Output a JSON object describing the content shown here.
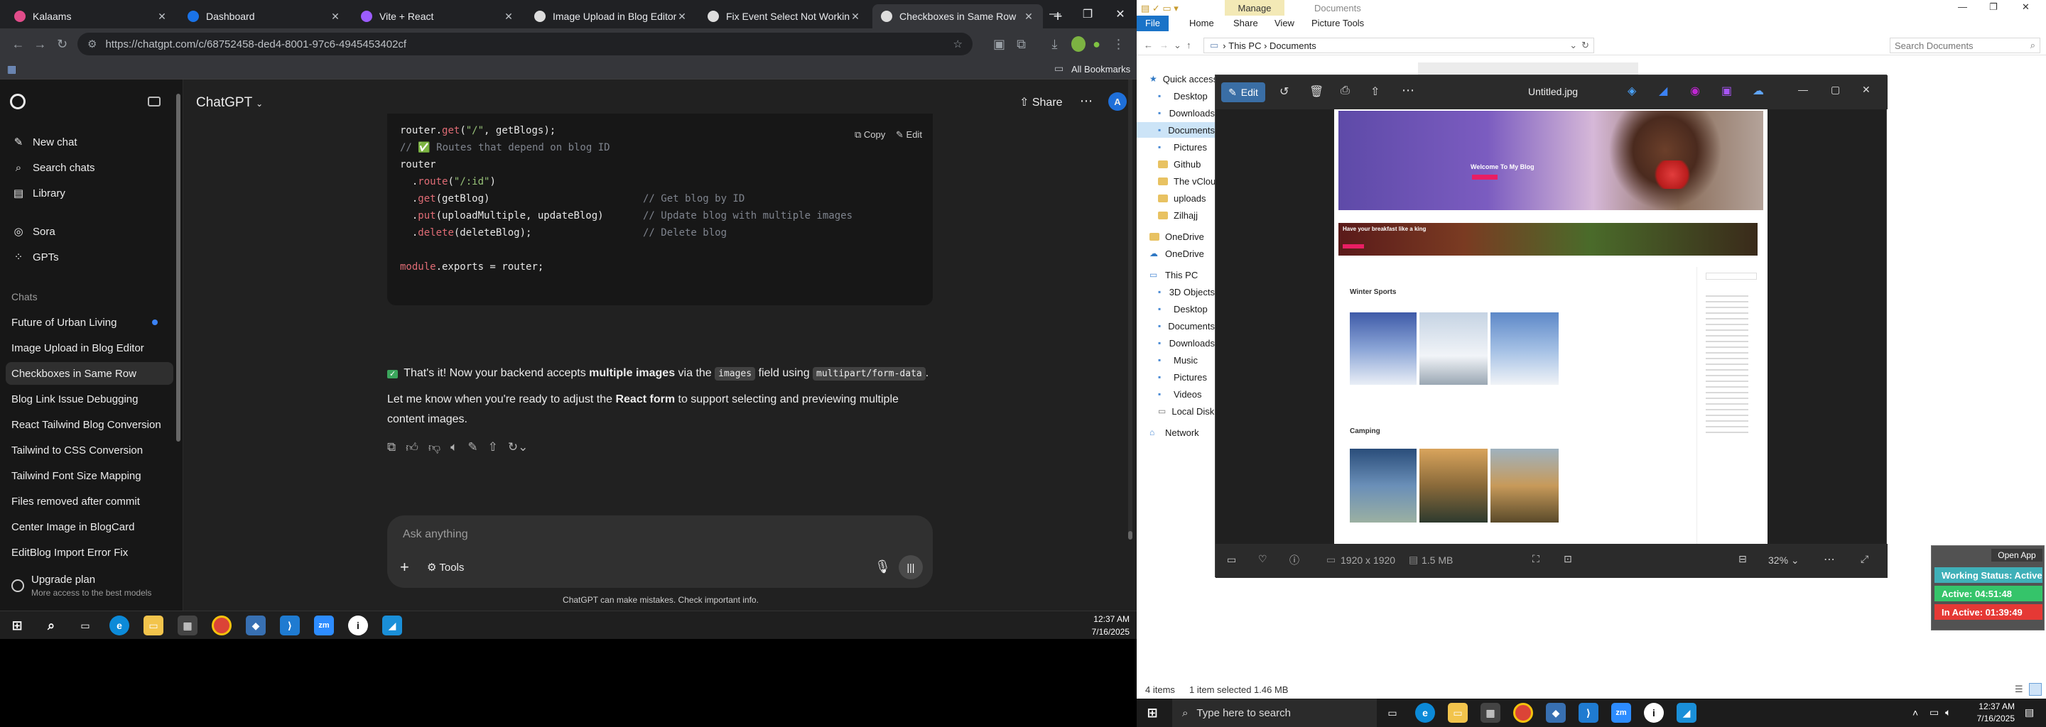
{
  "browser": {
    "tabs": [
      {
        "title": "Kalaams",
        "color": "#e14c8a"
      },
      {
        "title": "Dashboard",
        "color": "#1a73e8"
      },
      {
        "title": "Vite + React",
        "color": "#9c5cff"
      },
      {
        "title": "Image Upload in Blog Editor",
        "color": "#dddddd"
      },
      {
        "title": "Fix Event Select Not Working",
        "color": "#dddddd"
      },
      {
        "title": "Checkboxes in Same Row",
        "color": "#dddddd",
        "active": true
      }
    ],
    "url": "https://chatgpt.com/c/68752458-ded4-8001-97c6-4945453402cf",
    "all_bookmarks": "All Bookmarks"
  },
  "chatgpt": {
    "title": "ChatGPT",
    "share_label": "Share",
    "avatar_letter": "A",
    "sidebar": {
      "new_chat": "New chat",
      "search_chats": "Search chats",
      "library": "Library",
      "sora": "Sora",
      "gpts": "GPTs",
      "chats_heading": "Chats",
      "chats": [
        "Future of Urban Living",
        "Image Upload in Blog Editor",
        "Checkboxes in Same Row",
        "Blog Link Issue Debugging",
        "React Tailwind Blog Conversion",
        "Tailwind to CSS Conversion",
        "Tailwind Font Size Mapping",
        "Files removed after commit",
        "Center Image in BlogCard",
        "EditBlog Import Error Fix"
      ],
      "upgrade_title": "Upgrade plan",
      "upgrade_sub": "More access to the best models"
    },
    "code": {
      "copy": "Copy",
      "edit": "Edit",
      "lines": [
        {
          "pre": "router.",
          "fn": "get",
          "args": "(\"/\", getBlogs);",
          "comment": ""
        },
        {
          "pre": "",
          "fn": "",
          "args": "",
          "comment": "// ✅ Routes that depend on blog ID"
        },
        {
          "pre": "router",
          "fn": "",
          "args": "",
          "comment": ""
        },
        {
          "pre": "  .",
          "fn": "route",
          "args": "(\"/:id\")",
          "comment": ""
        },
        {
          "pre": "  .",
          "fn": "get",
          "args": "(getBlog)",
          "comment": "// Get blog by ID"
        },
        {
          "pre": "  .",
          "fn": "put",
          "args": "(uploadMultiple, updateBlog)",
          "comment": "// Update blog with multiple images"
        },
        {
          "pre": "  .",
          "fn": "delete",
          "args": "(deleteBlog);",
          "comment": "// Delete blog"
        },
        {
          "pre": "",
          "fn": "",
          "args": "",
          "comment": ""
        },
        {
          "pre": "module",
          "fn": "",
          "args": ".exports = router;",
          "comment": ""
        }
      ]
    },
    "message": {
      "p1_a": "That's it! Now your backend accepts ",
      "p1_b": "multiple images",
      "p1_c": " via the ",
      "p1_code1": "images",
      "p1_d": " field using ",
      "p1_code2": "multipart/form-data",
      "p1_e": ".",
      "p2_a": "Let me know when you're ready to adjust the ",
      "p2_b": "React form",
      "p2_c": " to support selecting and previewing multiple",
      "p2_d": "content images."
    },
    "composer": {
      "placeholder": "Ask anything",
      "tools": "Tools"
    },
    "disclaimer": "ChatGPT can make mistakes. Check important info."
  },
  "taskbar_left": {
    "time": "12:37 AM",
    "date": "7/16/2025"
  },
  "explorer": {
    "manage": "Manage",
    "documents_title": "Documents",
    "tabs": [
      "File",
      "Home",
      "Share",
      "View",
      "Picture Tools"
    ],
    "breadcrumb": [
      "This PC",
      "Documents"
    ],
    "search_placeholder": "Search Documents",
    "nav": [
      {
        "label": "Quick access",
        "type": "star"
      },
      {
        "label": "Desktop",
        "type": "blue"
      },
      {
        "label": "Downloads",
        "type": "blue"
      },
      {
        "label": "Documents",
        "type": "blue",
        "selected": true
      },
      {
        "label": "Pictures",
        "type": "blue"
      },
      {
        "label": "Github",
        "type": "folder"
      },
      {
        "label": "The vCloud",
        "type": "folder"
      },
      {
        "label": "uploads",
        "type": "folder"
      },
      {
        "label": "Zilhajj",
        "type": "folder"
      },
      {
        "label": "OneDrive",
        "type": "folder"
      },
      {
        "label": "OneDrive",
        "type": "cloud"
      },
      {
        "label": "This PC",
        "type": "pc"
      },
      {
        "label": "3D Objects",
        "type": "blue"
      },
      {
        "label": "Desktop",
        "type": "blue"
      },
      {
        "label": "Documents",
        "type": "blue"
      },
      {
        "label": "Downloads",
        "type": "blue"
      },
      {
        "label": "Music",
        "type": "blue"
      },
      {
        "label": "Pictures",
        "type": "blue"
      },
      {
        "label": "Videos",
        "type": "blue"
      },
      {
        "label": "Local Disk (C:)",
        "type": "drive"
      },
      {
        "label": "Network",
        "type": "net"
      }
    ],
    "status_items": "4 items",
    "status_selected": "1 item selected  1.46 MB"
  },
  "photos": {
    "edit": "Edit",
    "filename": "Untitled.jpg",
    "dimensions": "1920 x 1920",
    "filesize": "1.5 MB",
    "zoom": "32%",
    "image_texts": {
      "hero": "Welcome To My Blog",
      "banner": "Have your breakfast like a king",
      "section1": "Winter Sports",
      "section2": "Camping"
    }
  },
  "widget": {
    "open_app": "Open App",
    "working": "Working Status: Active",
    "active": "Active: 04:51:48",
    "inactive": "In Active: 01:39:49"
  },
  "taskbar_right": {
    "search": "Type here to search",
    "time": "12:37 AM",
    "date": "7/16/2025"
  }
}
